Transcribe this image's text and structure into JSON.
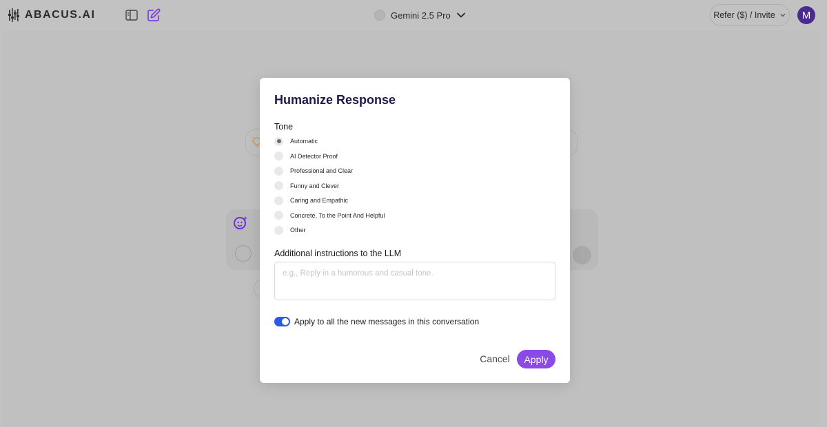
{
  "header": {
    "brand": "ABACUS.AI",
    "model_name": "Gemini 2.5 Pro",
    "refer_label": "Refer ($) / Invite",
    "avatar_initial": "M"
  },
  "modal": {
    "title": "Humanize Response",
    "tone_label": "Tone",
    "tone_options": [
      {
        "label": "Automatic",
        "selected": true
      },
      {
        "label": "AI Detector Proof",
        "selected": false
      },
      {
        "label": "Professional and Clear",
        "selected": false
      },
      {
        "label": "Funny and Clever",
        "selected": false
      },
      {
        "label": "Caring and Empathic",
        "selected": false
      },
      {
        "label": "Concrete, To the Point And Helpful",
        "selected": false
      },
      {
        "label": "Other",
        "selected": false
      }
    ],
    "instructions_label": "Additional instructions to the LLM",
    "instructions_placeholder": "e.g., Reply in a humorous and casual tone.",
    "instructions_value": "",
    "apply_all_label": "Apply to all the new messages in this conversation",
    "apply_all_enabled": true,
    "cancel_label": "Cancel",
    "apply_label": "Apply"
  },
  "colors": {
    "accent": "#8b4ae8",
    "toggle_on": "#2b5ce0",
    "title": "#1d1a4a",
    "avatar": "#4b2a8f",
    "overlay": "#c2c2c2"
  }
}
